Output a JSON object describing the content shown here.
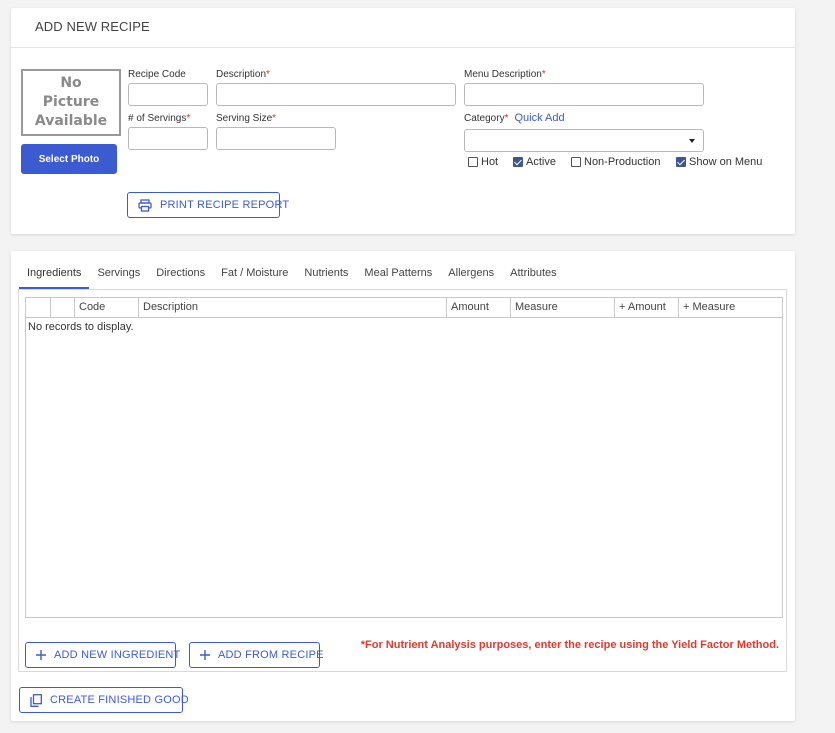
{
  "header": {
    "title": "ADD NEW RECIPE"
  },
  "photo": {
    "placeholder": "No\nPicture\nAvailable",
    "select_label": "Select Photo"
  },
  "fields": {
    "recipe_code": {
      "label": "Recipe Code",
      "value": ""
    },
    "description": {
      "label": "Description",
      "value": ""
    },
    "menu_description": {
      "label": "Menu Description",
      "value": ""
    },
    "servings": {
      "label": "# of Servings",
      "value": ""
    },
    "serving_size": {
      "label": "Serving Size",
      "value": ""
    },
    "category": {
      "label": "Category",
      "quick_add": "Quick Add",
      "value": ""
    },
    "required_mark": "*"
  },
  "checkboxes": [
    {
      "label": "Hot",
      "checked": false
    },
    {
      "label": "Active",
      "checked": true
    },
    {
      "label": "Non-Production",
      "checked": false
    },
    {
      "label": "Show on Menu",
      "checked": true
    }
  ],
  "print_button": {
    "label": "PRINT RECIPE REPORT",
    "icon": "printer-icon"
  },
  "tabs": [
    {
      "label": "Ingredients",
      "active": true
    },
    {
      "label": "Servings"
    },
    {
      "label": "Directions"
    },
    {
      "label": "Fat / Moisture"
    },
    {
      "label": "Nutrients"
    },
    {
      "label": "Meal Patterns"
    },
    {
      "label": "Allergens"
    },
    {
      "label": "Attributes"
    }
  ],
  "grid": {
    "columns": [
      "",
      "",
      "Code",
      "Description",
      "Amount",
      "Measure",
      "+ Amount",
      "+ Measure"
    ],
    "empty_message": "No records to display."
  },
  "buttons": {
    "add_ingredient": "ADD NEW INGREDIENT",
    "add_from_recipe": "ADD FROM RECIPE",
    "create_finished_good": "CREATE FINISHED GOOD"
  },
  "note": "*For Nutrient Analysis purposes, enter the recipe using the Yield Factor Method.",
  "colors": {
    "accent": "#3d5bd1",
    "required": "#d32f2f",
    "note": "#e03a2f"
  }
}
